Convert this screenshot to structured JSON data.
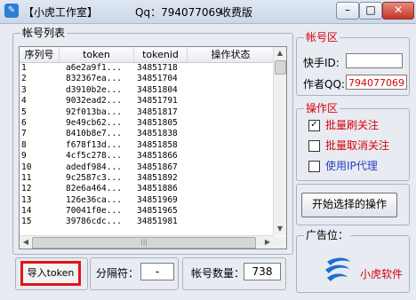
{
  "window": {
    "title": "【小虎工作室】",
    "qq_text": "Qq：794077069",
    "edition": "收费版",
    "buttons": {
      "minimize": "–",
      "maximize": "□",
      "close": "✕"
    }
  },
  "account_list": {
    "group_title": "帐号列表",
    "columns": [
      "序列号",
      "token",
      "tokenid",
      "操作状态"
    ],
    "rows": [
      {
        "seq": "1",
        "token": "a6e2a9f1...",
        "tokenid": "34851718",
        "status": ""
      },
      {
        "seq": "2",
        "token": "832367ea...",
        "tokenid": "34851704",
        "status": ""
      },
      {
        "seq": "3",
        "token": "d3910b2e...",
        "tokenid": "34851804",
        "status": ""
      },
      {
        "seq": "4",
        "token": "9032ead2...",
        "tokenid": "34851791",
        "status": ""
      },
      {
        "seq": "5",
        "token": "92f013ba...",
        "tokenid": "34851817",
        "status": ""
      },
      {
        "seq": "6",
        "token": "9e49cb62...",
        "tokenid": "34851805",
        "status": ""
      },
      {
        "seq": "7",
        "token": "8410b8e7...",
        "tokenid": "34851838",
        "status": ""
      },
      {
        "seq": "8",
        "token": "f678f13d...",
        "tokenid": "34851858",
        "status": ""
      },
      {
        "seq": "9",
        "token": "4cf5c278...",
        "tokenid": "34851866",
        "status": ""
      },
      {
        "seq": "10",
        "token": "adedf984...",
        "tokenid": "34851867",
        "status": ""
      },
      {
        "seq": "11",
        "token": "9c2587c3...",
        "tokenid": "34851892",
        "status": ""
      },
      {
        "seq": "12",
        "token": "82e6a464...",
        "tokenid": "34851886",
        "status": ""
      },
      {
        "seq": "13",
        "token": "126e36ca...",
        "tokenid": "34851969",
        "status": ""
      },
      {
        "seq": "14",
        "token": "70041f0e...",
        "tokenid": "34851965",
        "status": ""
      },
      {
        "seq": "15",
        "token": "39786cdc...",
        "tokenid": "34851981",
        "status": ""
      }
    ],
    "scroll_up": "▲",
    "scroll_down": "▼",
    "scroll_left": "◀",
    "scroll_right": "▶",
    "thumb_grip": "|||"
  },
  "bottom_bar": {
    "import_button": "导入token",
    "separator_label": "分隔符：",
    "separator_value": "-",
    "count_label": "帐号数量：",
    "count_value": "738"
  },
  "account_panel": {
    "title": "帐号区",
    "kuaishou_label": "快手ID:",
    "kuaishou_value": "",
    "author_label": "作者QQ:",
    "author_value": "794077069"
  },
  "operation_panel": {
    "title": "操作区",
    "options": [
      {
        "label": "批量刷关注",
        "checked": true,
        "check_mark": "✓",
        "color": "#d8000c"
      },
      {
        "label": "批量取消关注",
        "checked": false,
        "check_mark": "",
        "color": "#d8000c"
      },
      {
        "label": "使用IP代理",
        "checked": false,
        "check_mark": "",
        "color": "#2a3fbf"
      }
    ],
    "start_button": "开始选择的操作"
  },
  "ad_panel": {
    "title": "广告位：",
    "logo_icon": "swirl-logo-icon",
    "brand_text": "小虎软件",
    "brand_color": "#d8000c"
  },
  "colors": {
    "accent_red": "#d8000c",
    "highlight_border": "#e0161b",
    "window_bg": "#e8ebf1",
    "logo_blue": "#1d6fd0"
  }
}
